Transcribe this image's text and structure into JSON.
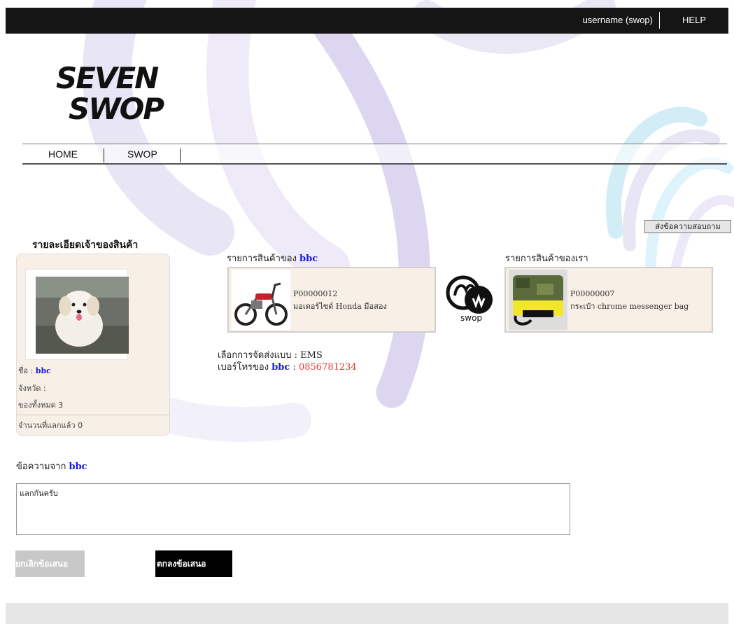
{
  "header": {
    "username": "username (swop)",
    "help": "HELP"
  },
  "brand": {
    "logo_text": [
      "SEVEN",
      "SWOP"
    ]
  },
  "nav": {
    "items": [
      {
        "label": "HOME"
      },
      {
        "label": "SWOP"
      }
    ]
  },
  "ask_button": "ส่งข้อความสอบถาม",
  "owner": {
    "title": "รายละเอียดเจ้าของสินค้า",
    "name_label": "ชื่อ : ",
    "name": "bbc",
    "province_label": "จังหวัด :",
    "items_label": "ของทั้งหมด 3",
    "swapped_label": "จำนวนที่แลกแล้ว 0"
  },
  "their_list": {
    "title_prefix": "รายการสินค้าของ ",
    "owner": "bbc",
    "product": {
      "code": "P00000012",
      "name": "มอเตอร์ไซด์ Honda มือสอง"
    }
  },
  "our_list": {
    "title": "รายการสินค้าของเรา",
    "product": {
      "code": "P00000007",
      "name": "กระเป๋า chrome messenger bag"
    }
  },
  "swop_logo_text": "swop",
  "shipping": {
    "label": "เลือกการจัดส่งแบบ : ",
    "value": "EMS"
  },
  "phone": {
    "prefix": "เบอร์โทรของ ",
    "owner": "bbc",
    "sep": " : ",
    "number": "0856781234"
  },
  "message": {
    "title_prefix": "ข้อความจาก ",
    "from": "bbc",
    "body": "แลกกันครับ"
  },
  "buttons": {
    "cancel": "ยกเลิกข้อเสนอ",
    "accept": "ตกลงข้อเสนอ"
  },
  "colors": {
    "accent_blue": "#1a1adc",
    "phone_red": "#ee3333",
    "card_bg": "#f8f0e6",
    "topbar": "#151515"
  }
}
